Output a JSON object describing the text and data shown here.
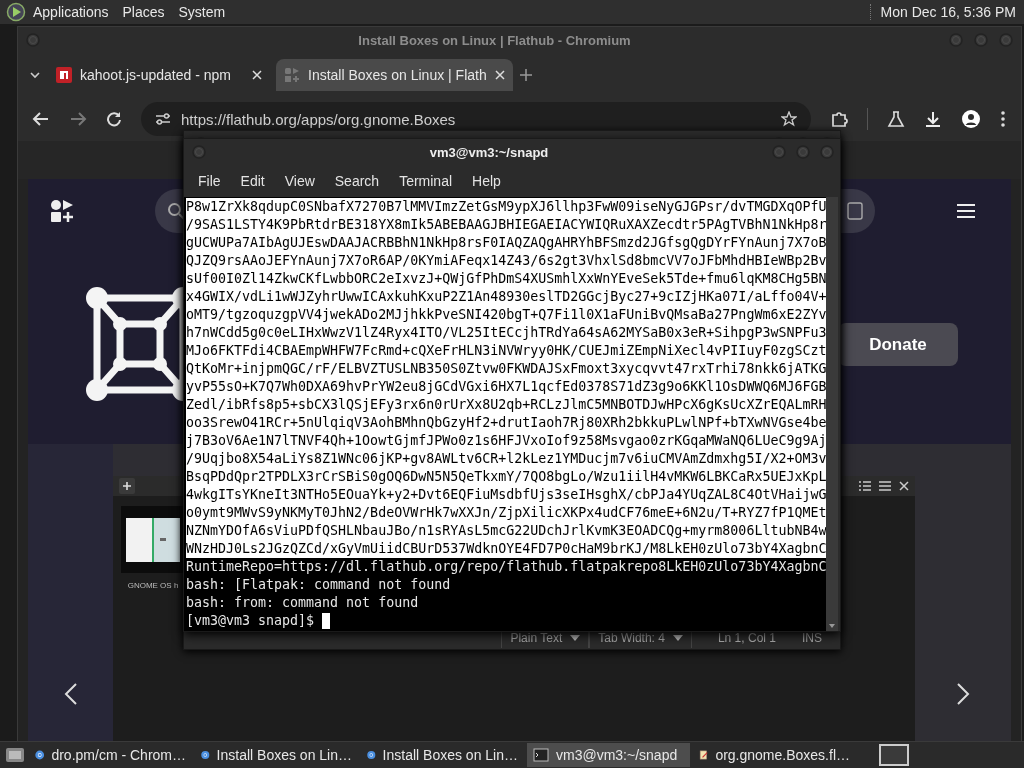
{
  "top_panel": {
    "menus": [
      "Applications",
      "Places",
      "System"
    ],
    "clock": "Mon Dec 16, 5:36 PM"
  },
  "browser": {
    "title": "Install Boxes on Linux | Flathub - Chromium",
    "tabs": [
      {
        "label": "kahoot.js-updated - npm",
        "kind": "package",
        "selected": false
      },
      {
        "label": "Install Boxes on Linux | Flath",
        "kind": "apps",
        "selected": true
      }
    ],
    "url": "https://flathub.org/apps/org.gnome.Boxes",
    "page": {
      "donate_button": "Donate",
      "screenshot_caption": "GNOME OS h"
    }
  },
  "editor": {
    "status_bar": {
      "language": "Plain Text",
      "tab_width": "Tab Width: 4",
      "position": "Ln 1, Col 1",
      "mode": "INS"
    }
  },
  "terminal": {
    "title": "vm3@vm3:~/snapd",
    "menus": [
      "File",
      "Edit",
      "View",
      "Search",
      "Terminal",
      "Help"
    ],
    "lines": [
      {
        "text": "P8w1ZrXk8qdupC0SNbafX7270B7lMMVImzZetGsM9ypXJ6llhp3FwW09iseNyGJGPsr/dvTMGDXqOPfU",
        "selected": true
      },
      {
        "text": "/9SAS1LSTY4K9PbRtdrBE318YX8mIk5ABEBAAGJBHIEGAEIACYWIQRuXAXZecdtr5PAgTVBhN1NkHp8r",
        "selected": true
      },
      {
        "text": "gUCWUPa7AIbAgUJEswDAAJACRBBhN1NkHp8rsF0IAQZAQgAHRYhBFSmzd2JGfsgQgDYrFYnAunj7X7oB",
        "selected": true
      },
      {
        "text": "QJZQ9rsAAoJEFYnAunj7X7oR6AP/0KYmiAFeqx14Z43/6s2gt3VhxlSd8bmcVV7oJFbMhdHBIeWBp2Bv",
        "selected": true
      },
      {
        "text": "sUf00I0Zl14ZkwCKfLwbbORC2eIxvzJ+QWjGfPhDmS4XUSmhlXxWnYEveSek5Tde+fmu6lqKM8CHg5BN",
        "selected": true
      },
      {
        "text": "x4GWIX/vdLi1wWJZyhrUwwICAxkuhKxuP2Z1An48930eslTD2GGcjByc27+9cIZjHKa07I/aLffo04V+",
        "selected": true
      },
      {
        "text": "oMT9/tgzoquzgpVV4jwekADo2MJjhkkPveSNI420bgT+Q7Fi1l0X1aFUniBvQMsaBa27PngWm6xE2ZYv",
        "selected": true
      },
      {
        "text": "h7nWCdd5g0c0eLIHxWwzV1lZ4Ryx4ITO/VL25ItECcjhTRdYa64sA62MYSaB0x3eR+SihpgP3wSNPFu3",
        "selected": true
      },
      {
        "text": "MJo6FKTFdi4CBAEmpWHFW7FcRmd+cQXeFrHLN3iNVWryy0HK/CUEJmiZEmpNiXecl4vPIIuyF0zgSCzt",
        "selected": true
      },
      {
        "text": "QtKoMr+injpmQGC/rF/ELBVZTUSLNB350S0Ztvw0FKWDAJSxFmoxt3xycqvvt47rxTrhi78nkk6jATKG",
        "selected": true
      },
      {
        "text": "yvP55sO+K7Q7Wh0DXA69hvPrYW2eu8jGCdVGxi6HX7L1qcfEd0378S71dZ3g9o6KKl1OsDWWQ6MJ6FGB",
        "selected": true
      },
      {
        "text": "Zedl/ibRfs8p5+sbCX3lQSjEFy3rx6n0rUrXx8U2qb+RCLzJlmC5MNBOTDJwHPcX6gKsUcXZrEQALmRH",
        "selected": true
      },
      {
        "text": "oo3SrewO41RCr+5nUlqiqV3AohBMhnQbGzyHf2+drutIaoh7Rj80XRh2bkkuPLwlNPf+bTXwNVGse4be",
        "selected": true
      },
      {
        "text": "j7B3oV6Ae1N7lTNVF4Qh+1OowtGjmfJPWo0z1s6HFJVxoIof9z58Msvgao0zrKGqaMWaNQ6LUeC9g9Aj",
        "selected": true
      },
      {
        "text": "/9Uqjbo8X54aLiYs8Z1WNc06jKP+gv8AWLtv6CR+l2kLez1YMDucjm7v6iuCMVAmZdmxhg5I/X2+OM3v",
        "selected": true
      },
      {
        "text": "BsqPDdQpr2TPDLX3rCrSBiS0gOQ6DwN5N5QeTkxmY/7QO8bgLo/Wzu1iilH4vMKW6LBKCaRx5UEJxKpL",
        "selected": true
      },
      {
        "text": "4wkgITsYKneIt3NTHo5EOuaYk+y2+Dvt6EQFiuMsdbfUjs3seIHsghX/cbPJa4YUqZAL8C4OtVHaijwG",
        "selected": true
      },
      {
        "text": "o0ymt9MWvS9yNKMyT0JhN2/BdeOVWrHk7wXXJn/ZjpXilicXKPx4udCF76meE+6N2u/T+RYZ7fP1QMEt",
        "selected": true
      },
      {
        "text": "NZNmYDOfA6sViuPDfQSHLNbauJBo/n1sRYAsL5mcG22UDchJrlKvmK3EOADCQg+myrm8006LltubNB4w",
        "selected": true
      },
      {
        "text": "WNzHDJ0Ls2JGzQZCd/xGyVmUiidCBUrD537WdknOYE4FD7P0cHaM9brKJ/M8LkEH0zUlo73bY4XagbnC",
        "selected": true
      },
      {
        "text": "RuntimeRepo=https://dl.flathub.org/repo/flathub.flatpakrepo8LkEH0zUlo73bY4XagbnC",
        "selected": false
      },
      {
        "text": "bash: [Flatpak: command not found",
        "selected": false
      },
      {
        "text": "bash: from: command not found",
        "selected": false
      }
    ],
    "prompt": "[vm3@vm3 snapd]$"
  },
  "taskbar": {
    "items": [
      {
        "label": "dro.pm/cm - Chrom…",
        "kind": "browser",
        "selected": false
      },
      {
        "label": "Install Boxes on Lin…",
        "kind": "browser",
        "selected": false
      },
      {
        "label": "Install Boxes on Lin…",
        "kind": "browser",
        "selected": false
      },
      {
        "label": "vm3@vm3:~/snapd",
        "kind": "terminal",
        "selected": true
      },
      {
        "label": "org.gnome.Boxes.fl…",
        "kind": "editor",
        "selected": false
      }
    ]
  }
}
